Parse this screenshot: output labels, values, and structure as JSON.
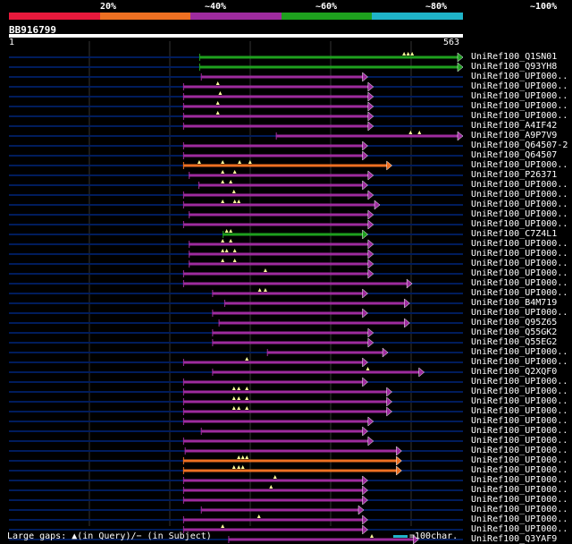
{
  "scale": {
    "labels": [
      "20%",
      "~40%",
      "~60%",
      "~80%",
      "~100%"
    ],
    "colors": [
      "#e8193c",
      "#ee7022",
      "#9e2b9e",
      "#1ea01e",
      "#1fb3c8"
    ]
  },
  "query": {
    "id": "BB916799",
    "start": "1",
    "end": "563",
    "length": 563
  },
  "colors": {
    "background": "#000000",
    "backbone": "#001c5c",
    "grid": "#333333",
    "gap": "#1a1060"
  },
  "hits": [
    {
      "label": "UniRef100_Q1SN01",
      "start": 236,
      "end": 563,
      "color": "#1ea01e",
      "query_gaps": [
        490,
        495,
        500
      ]
    },
    {
      "label": "UniRef100_Q93YH8",
      "start": 236,
      "end": 563,
      "color": "#1ea01e",
      "query_gaps": []
    },
    {
      "label": "UniRef100_UPI000..",
      "start": 238,
      "end": 445,
      "color": "#9e2b9e",
      "query_gaps": []
    },
    {
      "label": "UniRef100_UPI000..",
      "start": 216,
      "end": 452,
      "color": "#9e2b9e",
      "query_gaps": [
        259
      ]
    },
    {
      "label": "UniRef100_UPI000..",
      "start": 216,
      "end": 452,
      "color": "#9e2b9e",
      "query_gaps": [
        262
      ]
    },
    {
      "label": "UniRef100_UPI000..",
      "start": 216,
      "end": 452,
      "color": "#9e2b9e",
      "query_gaps": [
        259
      ]
    },
    {
      "label": "UniRef100_UPI000..",
      "start": 216,
      "end": 452,
      "color": "#9e2b9e",
      "query_gaps": [
        259
      ]
    },
    {
      "label": "UniRef100_A4IF42",
      "start": 216,
      "end": 452,
      "color": "#9e2b9e",
      "query_gaps": []
    },
    {
      "label": "UniRef100_A9P7V9",
      "start": 331,
      "end": 563,
      "color": "#9e2b9e",
      "query_gaps": [
        498,
        509
      ]
    },
    {
      "label": "UniRef100_Q64507-2",
      "start": 216,
      "end": 445,
      "color": "#9e2b9e",
      "query_gaps": []
    },
    {
      "label": "UniRef100_Q64507",
      "start": 216,
      "end": 445,
      "color": "#9e2b9e",
      "query_gaps": []
    },
    {
      "label": "UniRef100_UPI000..",
      "start": 216,
      "end": 475,
      "color": "#ee7022",
      "query_gaps": [
        236,
        265,
        286,
        299
      ]
    },
    {
      "label": "UniRef100_P26371",
      "start": 223,
      "end": 452,
      "color": "#9e2b9e",
      "query_gaps": [
        265,
        280
      ]
    },
    {
      "label": "UniRef100_UPI000..",
      "start": 235,
      "end": 445,
      "color": "#9e2b9e",
      "query_gaps": [
        265,
        275
      ]
    },
    {
      "label": "UniRef100_UPI000..",
      "start": 216,
      "end": 452,
      "color": "#9e2b9e",
      "query_gaps": [
        279
      ]
    },
    {
      "label": "UniRef100_UPI000..",
      "start": 216,
      "end": 460,
      "color": "#9e2b9e",
      "query_gaps": [
        265,
        280,
        285
      ]
    },
    {
      "label": "UniRef100_UPI000..",
      "start": 223,
      "end": 452,
      "color": "#9e2b9e",
      "query_gaps": []
    },
    {
      "label": "UniRef100_UPI000..",
      "start": 216,
      "end": 452,
      "color": "#9e2b9e",
      "query_gaps": []
    },
    {
      "label": "UniRef100_C7Z4L1",
      "start": 265,
      "end": 445,
      "color": "#1ea01e",
      "query_gaps": [
        270,
        275
      ]
    },
    {
      "label": "UniRef100_UPI000..",
      "start": 223,
      "end": 452,
      "color": "#9e2b9e",
      "query_gaps": [
        265,
        275
      ]
    },
    {
      "label": "UniRef100_UPI000..",
      "start": 223,
      "end": 452,
      "color": "#9e2b9e",
      "query_gaps": [
        265,
        270,
        280
      ]
    },
    {
      "label": "UniRef100_UPI000..",
      "start": 223,
      "end": 452,
      "color": "#9e2b9e",
      "query_gaps": [
        265,
        280
      ]
    },
    {
      "label": "UniRef100_UPI000..",
      "start": 216,
      "end": 452,
      "color": "#9e2b9e",
      "query_gaps": [
        318
      ]
    },
    {
      "label": "UniRef100_UPI000..",
      "start": 216,
      "end": 500,
      "color": "#9e2b9e",
      "query_gaps": []
    },
    {
      "label": "UniRef100_UPI000..",
      "start": 252,
      "end": 445,
      "color": "#9e2b9e",
      "query_gaps": [
        311,
        318
      ]
    },
    {
      "label": "UniRef100_B4M719",
      "start": 267,
      "end": 497,
      "color": "#9e2b9e",
      "query_gaps": []
    },
    {
      "label": "UniRef100_UPI000..",
      "start": 252,
      "end": 445,
      "color": "#9e2b9e",
      "query_gaps": []
    },
    {
      "label": "UniRef100_Q95Z65",
      "start": 260,
      "end": 497,
      "color": "#9e2b9e",
      "query_gaps": []
    },
    {
      "label": "UniRef100_Q55GK2",
      "start": 252,
      "end": 452,
      "color": "#9e2b9e",
      "query_gaps": []
    },
    {
      "label": "UniRef100_Q55EG2",
      "start": 252,
      "end": 452,
      "color": "#9e2b9e",
      "query_gaps": []
    },
    {
      "label": "UniRef100_UPI000..",
      "start": 320,
      "end": 470,
      "color": "#9e2b9e",
      "query_gaps": []
    },
    {
      "label": "UniRef100_UPI000..",
      "start": 216,
      "end": 445,
      "color": "#9e2b9e",
      "query_gaps": [
        295
      ]
    },
    {
      "label": "UniRef100_Q2XQF0",
      "start": 252,
      "end": 515,
      "color": "#9e2b9e",
      "query_gaps": [
        445
      ]
    },
    {
      "label": "UniRef100_UPI000..",
      "start": 216,
      "end": 445,
      "color": "#9e2b9e",
      "query_gaps": []
    },
    {
      "label": "UniRef100_UPI000..",
      "start": 216,
      "end": 475,
      "color": "#9e2b9e",
      "query_gaps": [
        279,
        285,
        295
      ]
    },
    {
      "label": "UniRef100_UPI000..",
      "start": 216,
      "end": 475,
      "color": "#9e2b9e",
      "query_gaps": [
        279,
        285,
        295
      ]
    },
    {
      "label": "UniRef100_UPI000..",
      "start": 216,
      "end": 475,
      "color": "#9e2b9e",
      "query_gaps": [
        279,
        285,
        295
      ]
    },
    {
      "label": "UniRef100_UPI000..",
      "start": 216,
      "end": 452,
      "color": "#9e2b9e",
      "query_gaps": []
    },
    {
      "label": "UniRef100_UPI000..",
      "start": 238,
      "end": 445,
      "color": "#9e2b9e",
      "query_gaps": []
    },
    {
      "label": "UniRef100_UPI000..",
      "start": 216,
      "end": 452,
      "color": "#9e2b9e",
      "query_gaps": []
    },
    {
      "label": "UniRef100_UPI000..",
      "start": 218,
      "end": 487,
      "color": "#9e2b9e",
      "query_gaps": []
    },
    {
      "label": "UniRef100_UPI000..",
      "start": 216,
      "end": 487,
      "color": "#ee7022",
      "query_gaps": [
        285,
        290,
        295
      ]
    },
    {
      "label": "UniRef100_UPI000..",
      "start": 216,
      "end": 487,
      "color": "#ee7022",
      "query_gaps": [
        279,
        285,
        290
      ]
    },
    {
      "label": "UniRef100_UPI000..",
      "start": 216,
      "end": 445,
      "color": "#9e2b9e",
      "query_gaps": [
        330
      ]
    },
    {
      "label": "UniRef100_UPI000..",
      "start": 216,
      "end": 445,
      "color": "#9e2b9e",
      "query_gaps": [
        325
      ]
    },
    {
      "label": "UniRef100_UPI000..",
      "start": 216,
      "end": 445,
      "color": "#9e2b9e",
      "query_gaps": []
    },
    {
      "label": "UniRef100_UPI000..",
      "start": 238,
      "end": 440,
      "color": "#9e2b9e",
      "query_gaps": []
    },
    {
      "label": "UniRef100_UPI000..",
      "start": 216,
      "end": 445,
      "color": "#9e2b9e",
      "query_gaps": [
        310
      ]
    },
    {
      "label": "UniRef100_UPI000..",
      "start": 216,
      "end": 445,
      "color": "#9e2b9e",
      "query_gaps": [
        265
      ]
    },
    {
      "label": "UniRef100_Q3YAF9",
      "start": 272,
      "end": 508,
      "color": "#9e2b9e",
      "query_gaps": [
        450
      ]
    }
  ],
  "footer": {
    "gaps_text": "Large gaps: ▲(in Query)/− (in Subject)",
    "scale_text": "=100char."
  }
}
